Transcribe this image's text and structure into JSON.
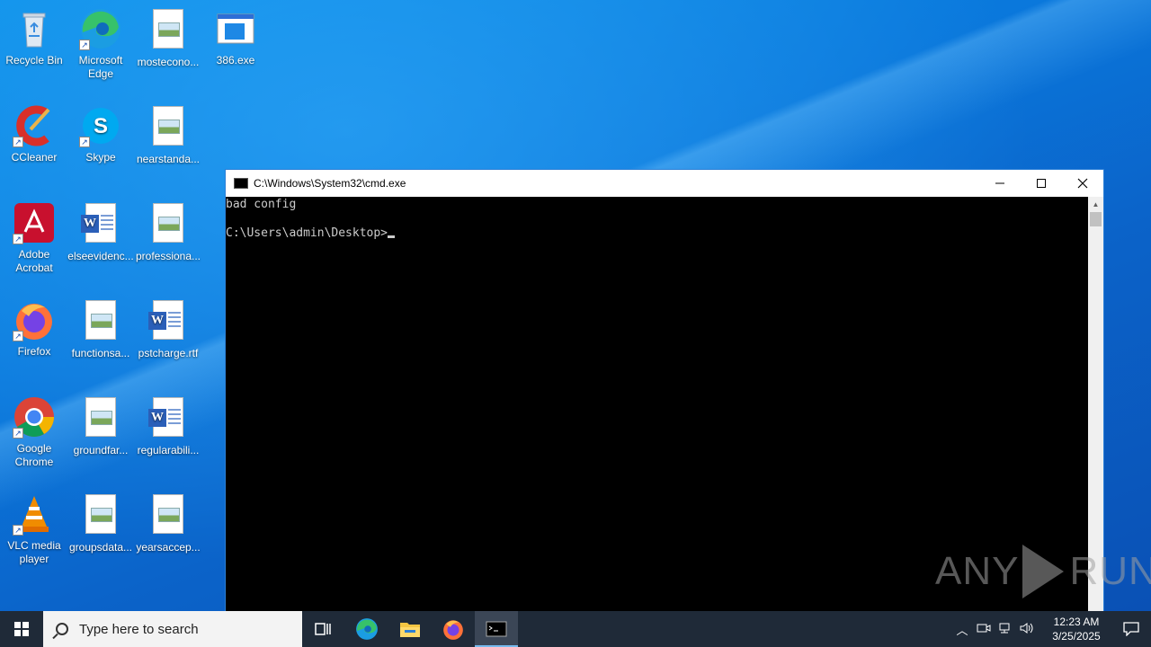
{
  "desktop": {
    "icons": [
      {
        "label": "Recycle Bin"
      },
      {
        "label": "Microsoft Edge"
      },
      {
        "label": "mosteconо..."
      },
      {
        "label": "386.exe"
      },
      {
        "label": "CCleaner"
      },
      {
        "label": "Skype"
      },
      {
        "label": "nearstanda..."
      },
      {
        "label": "Adobe Acrobat"
      },
      {
        "label": "elseevidenc..."
      },
      {
        "label": "professiona..."
      },
      {
        "label": "Firefox"
      },
      {
        "label": "functionsa..."
      },
      {
        "label": "pstcharge.rtf"
      },
      {
        "label": "Google Chrome"
      },
      {
        "label": "groundfar..."
      },
      {
        "label": "regularabili..."
      },
      {
        "label": "VLC media player"
      },
      {
        "label": "groupsdata..."
      },
      {
        "label": "yearsaccep..."
      }
    ]
  },
  "cmd": {
    "title": "C:\\Windows\\System32\\cmd.exe",
    "lines": [
      "bad config",
      "",
      "C:\\Users\\admin\\Desktop>"
    ]
  },
  "watermark": {
    "left": "ANY",
    "right": "RUN"
  },
  "taskbar": {
    "search_placeholder": "Type here to search",
    "time": "12:23 AM",
    "date": "3/25/2025"
  },
  "colors": {
    "accent": "#0a78dc",
    "taskbar": "#1f2a38",
    "console_text": "#cccccc"
  }
}
